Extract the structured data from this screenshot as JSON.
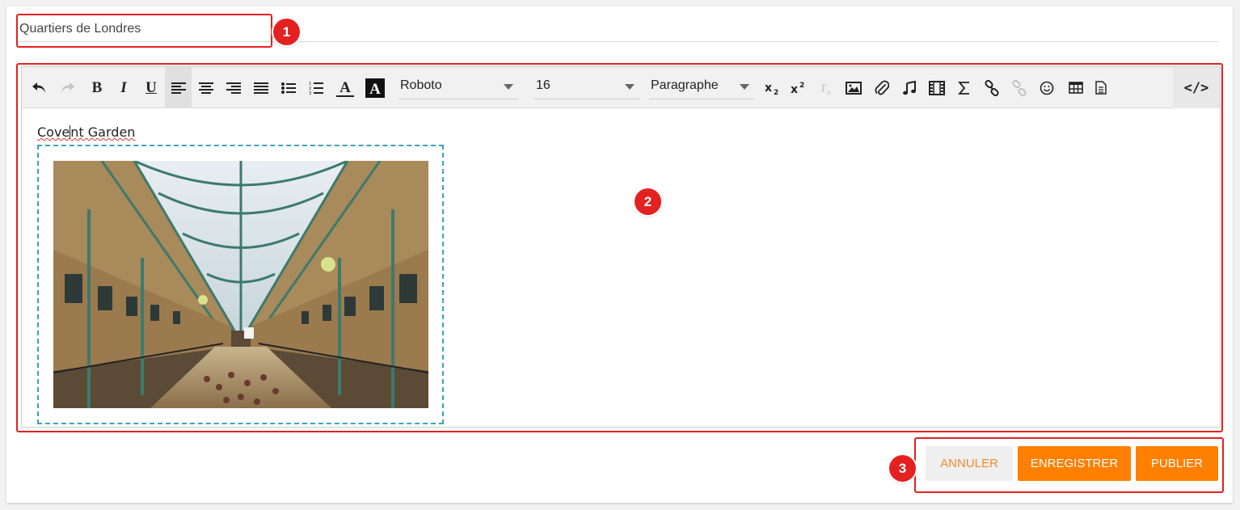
{
  "document": {
    "title_value": "Quartiers de Londres"
  },
  "toolbar": {
    "font_family": "Roboto",
    "font_size": "16",
    "block_format": "Paragraphe",
    "code_view_label": "</>"
  },
  "content": {
    "text_part1": "Cove",
    "text_part2": "nt Garden",
    "image_alt": "Covent Garden market hall"
  },
  "actions": {
    "cancel_label": "ANNULER",
    "save_label": "ENREGISTRER",
    "publish_label": "PUBLIER"
  },
  "annotations": {
    "badge_1": "1",
    "badge_2": "2",
    "badge_3": "3"
  },
  "colors": {
    "accent_orange": "#ff7f00",
    "annotation_red": "#e42121",
    "image_frame_teal": "#3aa4b8"
  }
}
